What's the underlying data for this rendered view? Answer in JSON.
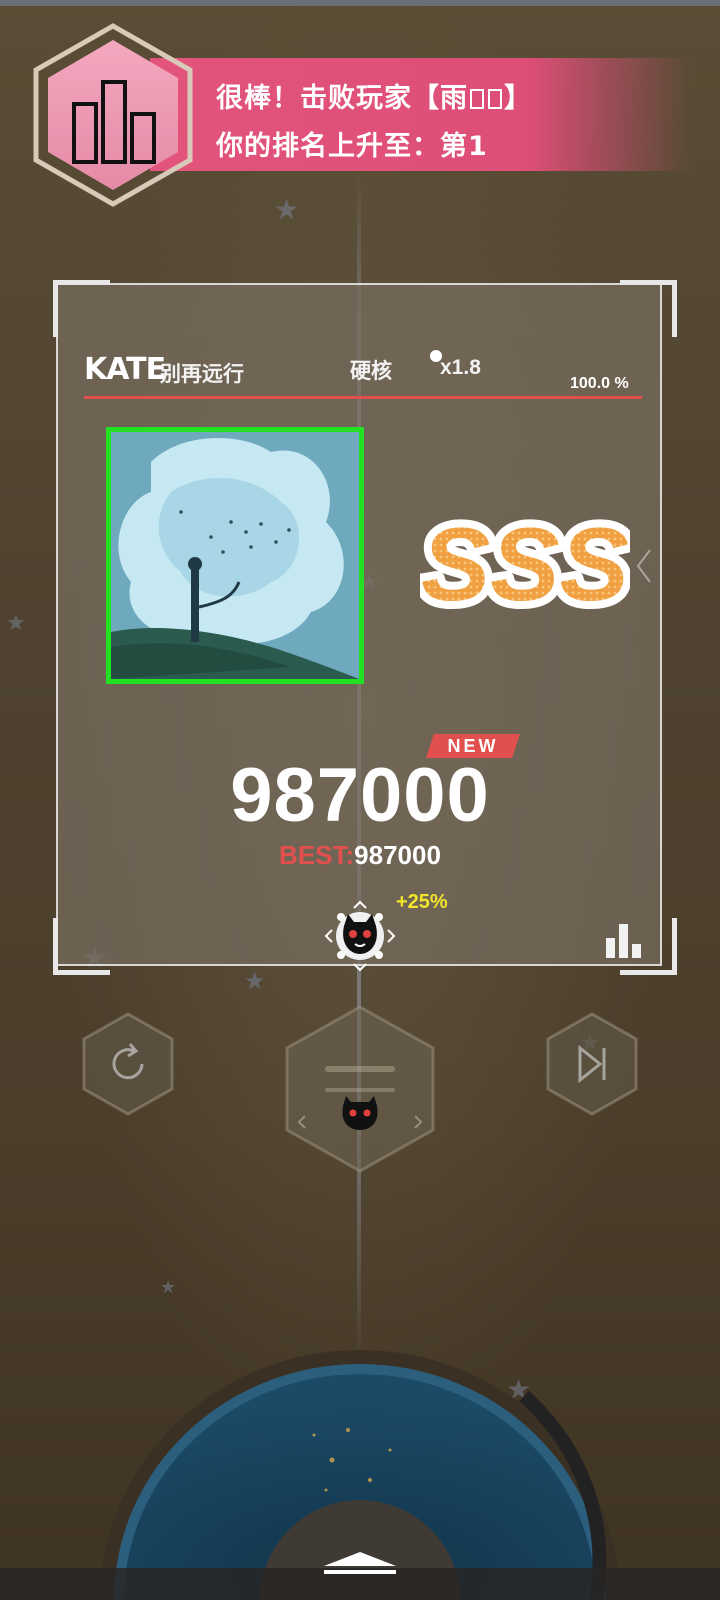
{
  "notification": {
    "line1": "很棒！击败玩家【雨",
    "line1_end": "】",
    "line2": "你的排名上升至：第1",
    "badge_icon": "leaderboard-icon"
  },
  "song": {
    "artist": "KATE",
    "title": "别再远行",
    "difficulty": "硬核",
    "speed": "x1.8",
    "accuracy": "100.0 %"
  },
  "result": {
    "rank": "SSS",
    "new_tag": "NEW",
    "score": "987000",
    "best_label": "BEST:",
    "best_value": "987000",
    "bonus": "+25%"
  },
  "colors": {
    "accent_red": "#e2504e",
    "banner_pink": "#e2547b",
    "cover_border": "#22e022",
    "rank_orange": "#f0a040",
    "bonus_yellow": "#f2e52a"
  },
  "icons": {
    "retry": "retry-icon",
    "next": "skip-next-icon",
    "character": "cat-character-icon",
    "stats": "stats-bars-icon",
    "expand": "up-chevron-icon"
  }
}
